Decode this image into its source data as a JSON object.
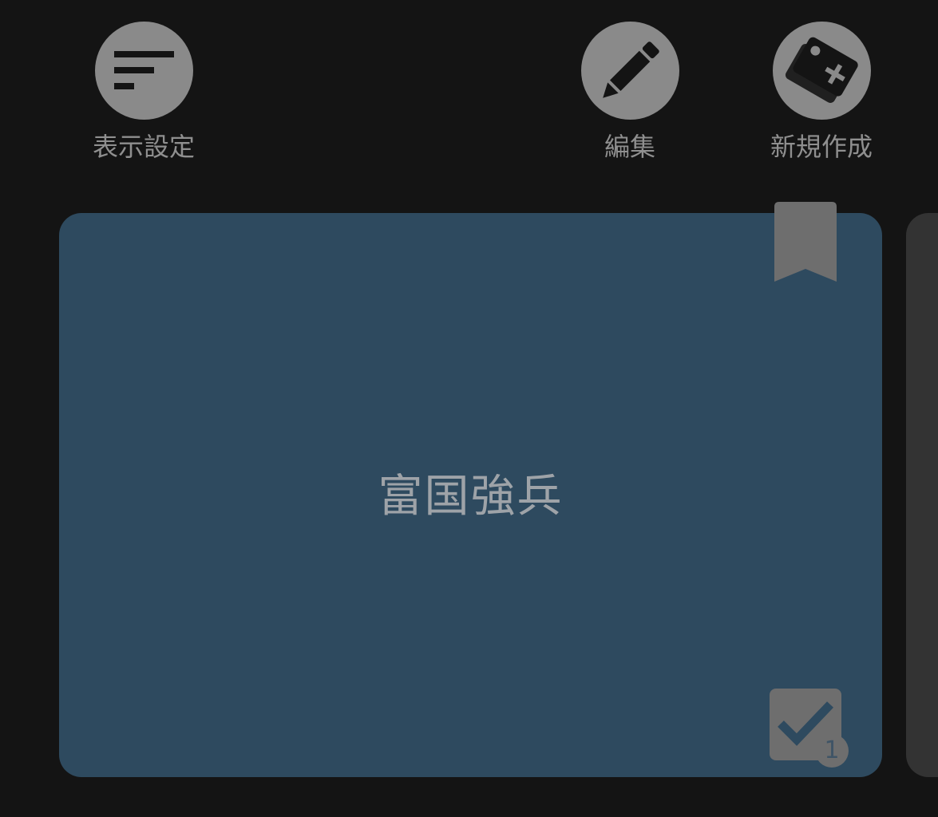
{
  "toolbar": {
    "display_settings_label": "表示設定",
    "edit_label": "編集",
    "new_label": "新規作成"
  },
  "icons": {
    "display_settings": "sort-lines-icon",
    "edit": "pencil-icon",
    "new": "add-card-icon",
    "bookmark": "bookmark-icon",
    "check": "checkmark-icon"
  },
  "card": {
    "title": "富国強兵",
    "check_count": "1"
  },
  "colors": {
    "background": "#141414",
    "card": "#2e4a5f",
    "icon_circle": "#8a8a8a",
    "label": "#8f8f8f",
    "next_card": "#333333"
  }
}
